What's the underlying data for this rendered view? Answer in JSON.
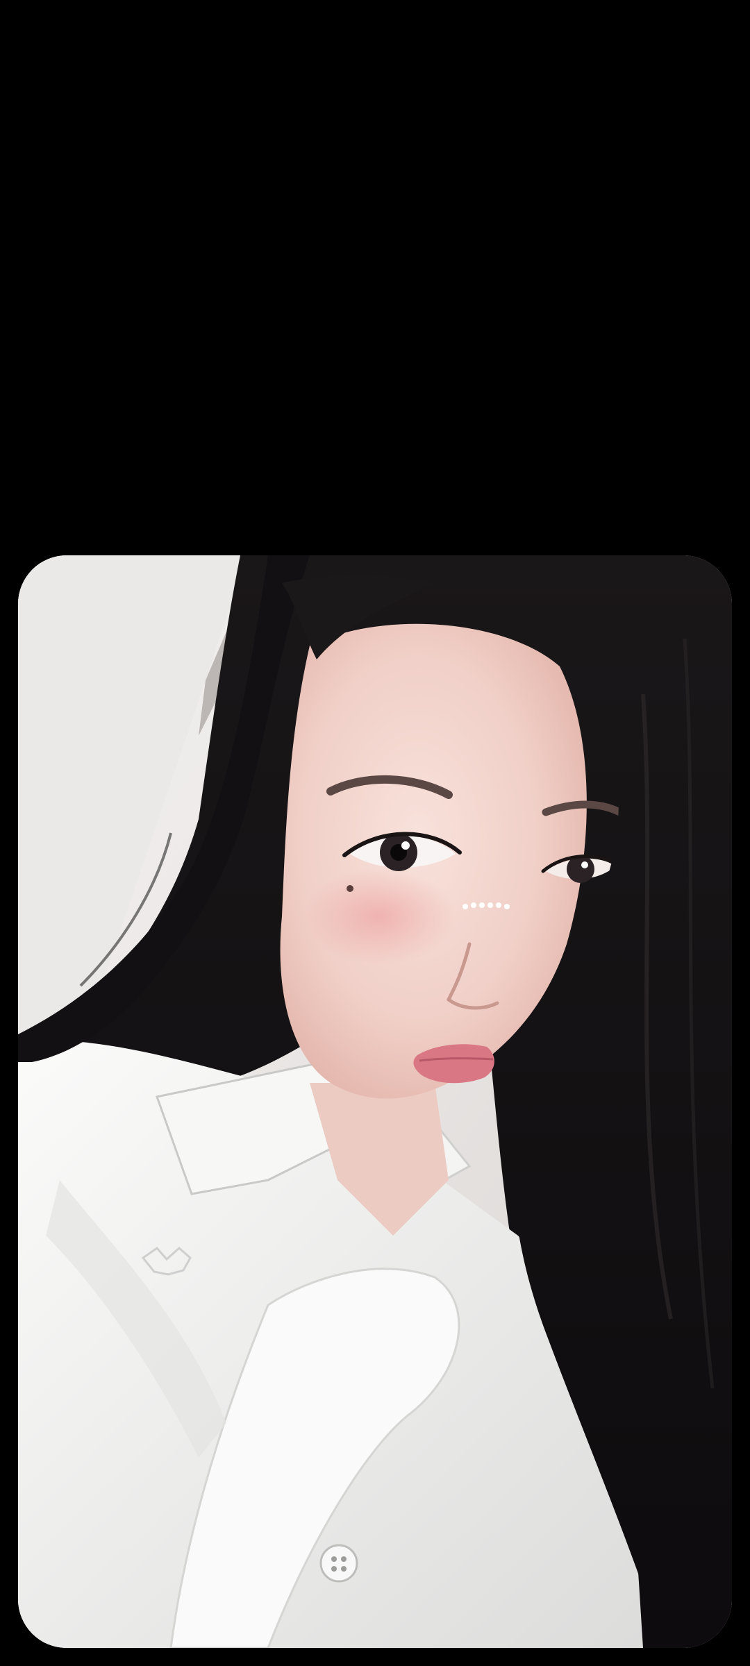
{
  "screen": {
    "background": "#000000"
  },
  "photo": {
    "subject": "selfie-portrait",
    "colors": {
      "background_wall": "#e9e6e4",
      "hair": "#141214",
      "skin": "#f3d8d0",
      "shirt": "#f1f1f0",
      "lips": "#d97884"
    }
  }
}
